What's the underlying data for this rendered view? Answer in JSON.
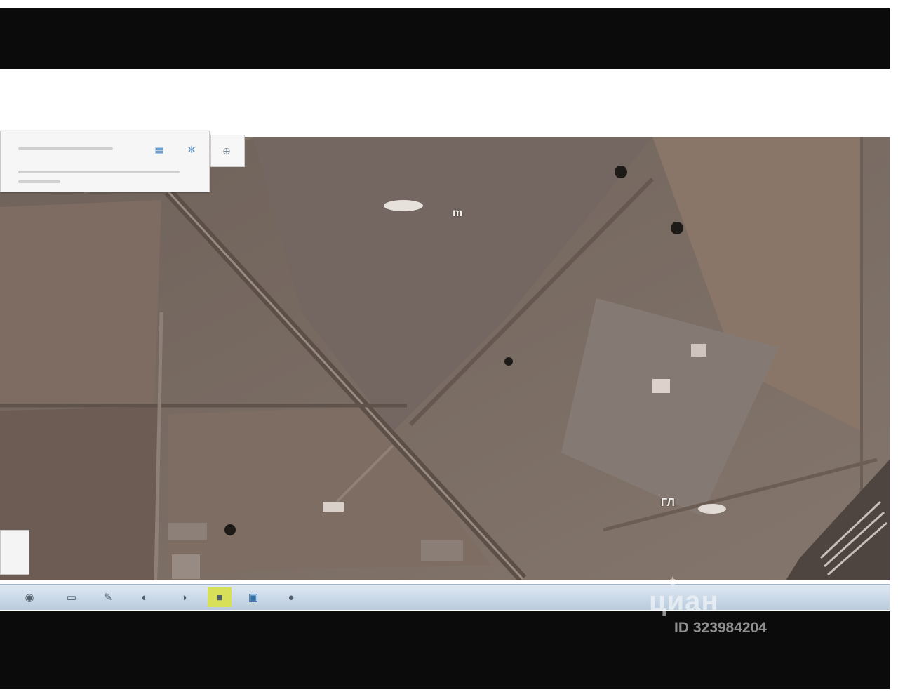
{
  "watermark": {
    "brand": "циан",
    "listing_id": "ID 323984204"
  },
  "map": {
    "label_marker_1": "m",
    "label_marker_2": "ГЛ"
  },
  "colors": {
    "frame": "#0b0b0b",
    "terrain": "#7a6a62",
    "taskbar": "#c9d8e7",
    "taskbar_highlight": "#d8e05a"
  },
  "taskbar": {
    "icons": [
      "start-orb-icon",
      "window-icon",
      "pin-icon",
      "folder-icon",
      "media-icon",
      "active-app-icon",
      "monitor-icon",
      "tray-icon"
    ]
  }
}
